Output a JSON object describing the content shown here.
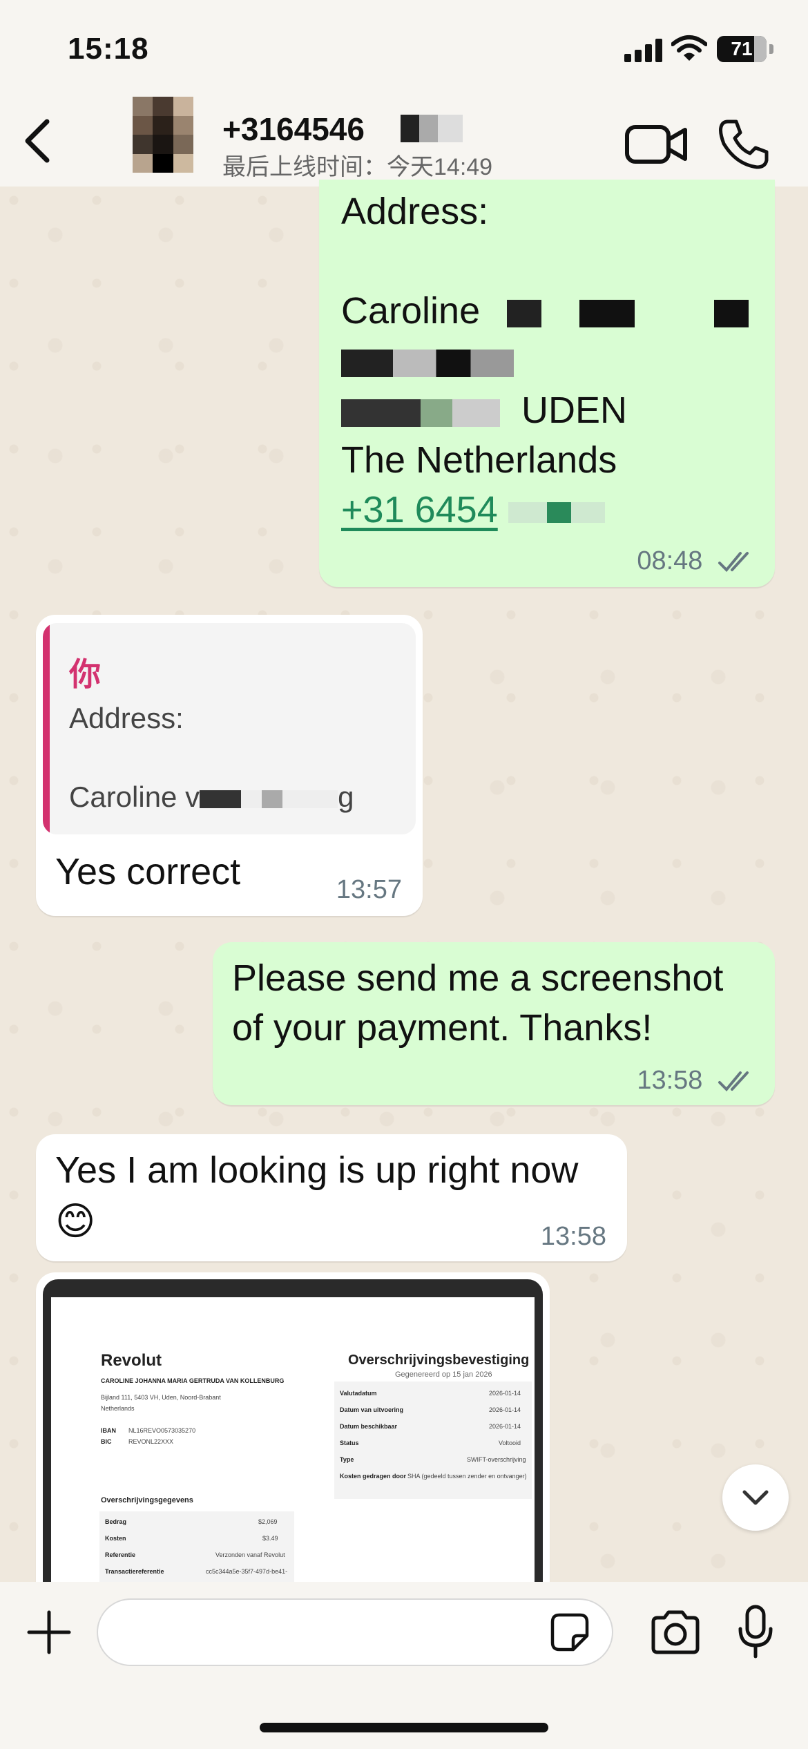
{
  "status_bar": {
    "time": "15:18",
    "battery": "71"
  },
  "header": {
    "contact_name": "+3164546",
    "last_seen": "最后上线时间：今天14:49"
  },
  "messages": {
    "m1": {
      "line_address": "Address:",
      "line_name": "Caroline",
      "line_city": "UDEN",
      "line_country": "The Netherlands",
      "phone": "+31 6454",
      "time": "08:48"
    },
    "m2": {
      "quote_author": "你",
      "quote_line1": "Address:",
      "quote_line2": "Caroline v",
      "quote_tail": "g",
      "text": "Yes correct",
      "time": "13:57"
    },
    "m3": {
      "text": "Please send me a screenshot of your payment. Thanks!",
      "time": "13:58"
    },
    "m4": {
      "text": "Yes I am looking is up right now",
      "emoji": "😊",
      "time": "13:58"
    },
    "m5": {
      "doc_logo": "Revolut",
      "doc_title": "Overschrijvingsbevestiging",
      "doc_sub": "Gegenereerd op 15 jan 2026",
      "account_name": "CAROLINE JOHANNA MARIA GERTRUDA VAN KOLLENBURG",
      "account_addr": "Bijland 111, 5403 VH, Uden, Noord-Brabant",
      "account_country": "Netherlands",
      "iban_label": "IBAN",
      "iban_value": "NL16REVO0573035270",
      "bic_label": "BIC",
      "bic_value": "REVONL22XXX",
      "section_title": "Overschrijvingsgegevens",
      "rows_left": [
        {
          "label": "Bedrag",
          "value": "$2,069"
        },
        {
          "label": "Kosten",
          "value": "$3.49"
        },
        {
          "label": "Referentie",
          "value": "Verzonden vanaf Revolut"
        },
        {
          "label": "Transactiereferentie",
          "value": "cc5c344a5e-35f7-497d-be41-"
        }
      ],
      "rows_right": [
        {
          "label": "Valutadatum",
          "value": "2026-01-14"
        },
        {
          "label": "Datum van uitvoering",
          "value": "2026-01-14"
        },
        {
          "label": "Datum beschikbaar",
          "value": "2026-01-14"
        },
        {
          "label": "Status",
          "value": "Voltooid"
        },
        {
          "label": "Type",
          "value": "SWIFT-overschrijving"
        },
        {
          "label": "Kosten gedragen door",
          "value": "SHA (gedeeld tussen zender en ontvanger)"
        }
      ]
    }
  },
  "input": {
    "placeholder": ""
  },
  "colors": {
    "outgoing_bubble": "#d9fdd3",
    "incoming_bubble": "#ffffff",
    "quote_accent": "#d3326f",
    "link": "#1f8a5a"
  }
}
